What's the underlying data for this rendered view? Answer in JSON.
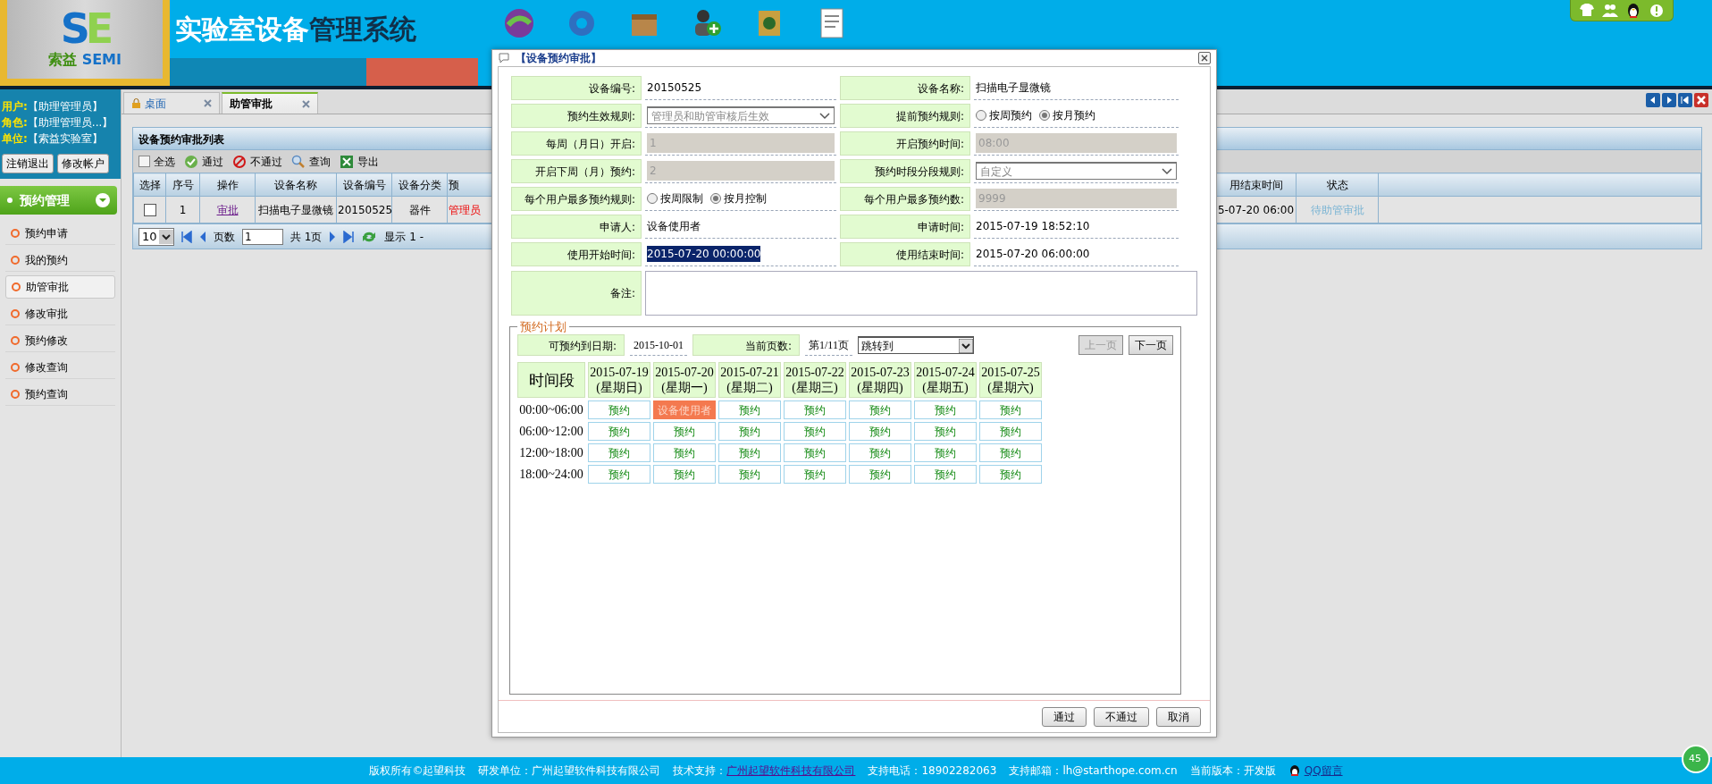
{
  "header": {
    "logo": {
      "mark": "SE",
      "brand_cn": "索益",
      "brand_en": "SEMI"
    },
    "title_parts": [
      "实验室设备",
      "管理系统"
    ]
  },
  "user_info": [
    {
      "label": "用户:",
      "value": "【助理管理员】"
    },
    {
      "label": "角色:",
      "value": "【助理管理员...】"
    },
    {
      "label": "单位:",
      "value": "【索益实验室】"
    }
  ],
  "account_buttons": [
    "注销退出",
    "修改帐户"
  ],
  "menu": {
    "title": "预约管理",
    "expanded": true,
    "items": [
      {
        "label": "预约申请",
        "selected": false
      },
      {
        "label": "我的预约",
        "selected": false
      },
      {
        "label": "助管审批",
        "selected": true
      },
      {
        "label": "修改审批",
        "selected": false
      },
      {
        "label": "预约修改",
        "selected": false
      },
      {
        "label": "修改查询",
        "selected": false
      },
      {
        "label": "预约查询",
        "selected": false
      }
    ]
  },
  "tabs": [
    {
      "label": "桌面",
      "selected": false
    },
    {
      "label": "助管审批",
      "selected": true
    }
  ],
  "grid": {
    "title": "设备预约审批列表",
    "toolbar": [
      {
        "kind": "checkbox",
        "label": "全选",
        "checked": false
      },
      {
        "kind": "pass",
        "label": "通过"
      },
      {
        "kind": "reject",
        "label": "不通过"
      },
      {
        "kind": "search",
        "label": "查询"
      },
      {
        "kind": "export",
        "label": "导出"
      }
    ],
    "left_columns": [
      "选择",
      "序号",
      "操作",
      "设备名称",
      "设备编号",
      "设备分类",
      "预"
    ],
    "right_columns": [
      "用结束时间",
      "状态"
    ],
    "rows": [
      {
        "checked": false,
        "index": "1",
        "action": "审批",
        "name": "扫描电子显微镜",
        "code": "20150525",
        "category": "器件",
        "column_7": "管理员",
        "end_time": "5-07-20 06:00",
        "status": "待助管审批"
      }
    ],
    "pager": {
      "page_size": "10",
      "page_label": "页数",
      "page": "1",
      "total": "共 1页",
      "display": "显示 1 -"
    }
  },
  "dialog": {
    "title": "【设备预约审批】",
    "fields": [
      {
        "label": "设备编号:",
        "kind": "text",
        "value": "20150525",
        "highlighted": false
      },
      {
        "label": "设备名称:",
        "kind": "text",
        "value": "扫描电子显微镜",
        "highlighted": false
      },
      {
        "label": "预约生效规则:",
        "kind": "select",
        "value": "管理员和助管审核后生效"
      },
      {
        "label": "提前预约规则:",
        "kind": "radio",
        "options": [
          {
            "label": "按周预约",
            "selected": false
          },
          {
            "label": "按月预约",
            "selected": true
          }
        ]
      },
      {
        "label": "每周（月日）开启:",
        "kind": "readonly",
        "value": "1"
      },
      {
        "label": "开启预约时间:",
        "kind": "readonly",
        "value": "08:00"
      },
      {
        "label": "开启下周（月）预约:",
        "kind": "readonly",
        "value": "2"
      },
      {
        "label": "预约时段分段规则:",
        "kind": "select",
        "value": "自定义"
      },
      {
        "label": "每个用户最多预约规则:",
        "kind": "radio",
        "options": [
          {
            "label": "按周限制",
            "selected": false
          },
          {
            "label": "按月控制",
            "selected": true
          }
        ]
      },
      {
        "label": "每个用户最多预约数:",
        "kind": "readonly",
        "value": "9999"
      },
      {
        "label": "申请人:",
        "kind": "text",
        "value": "设备使用者",
        "highlighted": false
      },
      {
        "label": "申请时间:",
        "kind": "text",
        "value": "2015-07-19 18:52:10",
        "highlighted": false
      },
      {
        "label": "使用开始时间:",
        "kind": "text",
        "value": "2015-07-20 00:00:00",
        "highlighted": true
      },
      {
        "label": "使用结束时间:",
        "kind": "text",
        "value": "2015-07-20 06:00:00",
        "highlighted": false
      }
    ],
    "remark": {
      "label": "备注:"
    },
    "schedule": {
      "legend": "预约计划",
      "until_label": "可预约到日期:",
      "until": "2015-10-01",
      "page_label": "当前页数:",
      "page": "第1/11页",
      "jump": "跳转到",
      "prev": {
        "label": "上一页",
        "disabled": true
      },
      "next": {
        "label": "下一页",
        "disabled": false
      },
      "corner": "时间段",
      "days": [
        {
          "date": "2015-07-19",
          "weekday": "(星期日)"
        },
        {
          "date": "2015-07-20",
          "weekday": "(星期一)"
        },
        {
          "date": "2015-07-21",
          "weekday": "(星期二)"
        },
        {
          "date": "2015-07-22",
          "weekday": "(星期三)"
        },
        {
          "date": "2015-07-23",
          "weekday": "(星期四)"
        },
        {
          "date": "2015-07-24",
          "weekday": "(星期五)"
        },
        {
          "date": "2015-07-25",
          "weekday": "(星期六)"
        }
      ],
      "rows": [
        {
          "time": "00:00~06:00",
          "slots": [
            {
              "text": "预约",
              "booked": false
            },
            {
              "text": "设备使用者",
              "booked": true
            },
            {
              "text": "预约",
              "booked": false
            },
            {
              "text": "预约",
              "booked": false
            },
            {
              "text": "预约",
              "booked": false
            },
            {
              "text": "预约",
              "booked": false
            },
            {
              "text": "预约",
              "booked": false
            }
          ]
        },
        {
          "time": "06:00~12:00",
          "slots": [
            {
              "text": "预约",
              "booked": false
            },
            {
              "text": "预约",
              "booked": false
            },
            {
              "text": "预约",
              "booked": false
            },
            {
              "text": "预约",
              "booked": false
            },
            {
              "text": "预约",
              "booked": false
            },
            {
              "text": "预约",
              "booked": false
            },
            {
              "text": "预约",
              "booked": false
            }
          ]
        },
        {
          "time": "12:00~18:00",
          "slots": [
            {
              "text": "预约",
              "booked": false
            },
            {
              "text": "预约",
              "booked": false
            },
            {
              "text": "预约",
              "booked": false
            },
            {
              "text": "预约",
              "booked": false
            },
            {
              "text": "预约",
              "booked": false
            },
            {
              "text": "预约",
              "booked": false
            },
            {
              "text": "预约",
              "booked": false
            }
          ]
        },
        {
          "time": "18:00~24:00",
          "slots": [
            {
              "text": "预约",
              "booked": false
            },
            {
              "text": "预约",
              "booked": false
            },
            {
              "text": "预约",
              "booked": false
            },
            {
              "text": "预约",
              "booked": false
            },
            {
              "text": "预约",
              "booked": false
            },
            {
              "text": "预约",
              "booked": false
            },
            {
              "text": "预约",
              "booked": false
            }
          ]
        }
      ]
    },
    "buttons": [
      "通过",
      "不通过",
      "取消"
    ]
  },
  "footer": {
    "items": [
      {
        "kind": "text",
        "text": "版权所有©起望科技"
      },
      {
        "kind": "text",
        "text": "研发单位：广州起望软件科技有限公司"
      },
      {
        "kind": "link",
        "prefix": "技术支持：",
        "text": "广州起望软件科技有限公司"
      },
      {
        "kind": "text",
        "text": "支持电话：18902282063"
      },
      {
        "kind": "text",
        "text": "支持邮箱：lh@starthope.com.cn"
      },
      {
        "kind": "text",
        "text": "当前版本：开发版"
      },
      {
        "kind": "qq",
        "text": "QQ留言"
      }
    ],
    "badge": "45"
  }
}
